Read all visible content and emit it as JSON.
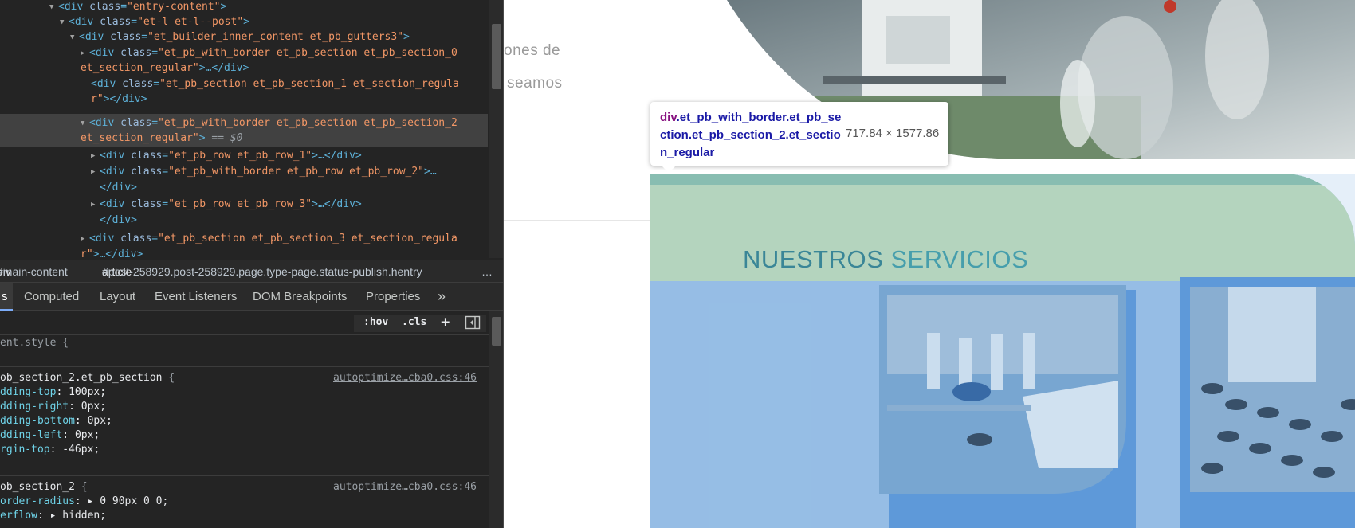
{
  "devtools": {
    "dom_tree": {
      "lines": [
        {
          "open": "<div ",
          "attr": "class",
          "value": "\"entry-content\"",
          "close": ">"
        },
        {
          "open": "<div ",
          "attr": "class",
          "value": "\"et-l et-l--post\"",
          "close": ">"
        },
        {
          "open": "<div ",
          "attr": "class",
          "value": "\"et_builder_inner_content et_pb_gutters3\"",
          "close": ">"
        },
        {
          "open": "<div ",
          "attr": "class",
          "value": "\"et_pb_with_border et_pb_section et_pb_section_0",
          "close": ""
        },
        {
          "open": "",
          "attr": "",
          "value": "et_section_regular\"",
          "close": ">…</div>"
        },
        {
          "open": "<div ",
          "attr": "class",
          "value": "\"et_pb_section et_pb_section_1 et_section_regula",
          "close": ""
        },
        {
          "open": "",
          "attr": "",
          "value": "r\"",
          "close": "></div>"
        },
        {
          "open": "<div ",
          "attr": "class",
          "value": "\"et_pb_with_border et_pb_section et_pb_section_2",
          "close": ""
        },
        {
          "open": "",
          "attr": "",
          "value": "et_section_regular\"",
          "close": ">",
          "suffix": " == $0"
        },
        {
          "open": "<div ",
          "attr": "class",
          "value": "\"et_pb_row et_pb_row_1\"",
          "close": ">…</div>"
        },
        {
          "open": "<div ",
          "attr": "class",
          "value": "\"et_pb_with_border et_pb_row et_pb_row_2\"",
          "close": ">…"
        },
        {
          "open": "</div>",
          "attr": "",
          "value": "",
          "close": ""
        },
        {
          "open": "<div ",
          "attr": "class",
          "value": "\"et_pb_row et_pb_row_3\"",
          "close": ">…</div>"
        },
        {
          "open": "</div>",
          "attr": "",
          "value": "",
          "close": ""
        },
        {
          "open": "<div ",
          "attr": "class",
          "value": "\"et_pb_section et_pb_section_3 et_section_regula",
          "close": ""
        },
        {
          "open": "",
          "attr": "",
          "value": "r\"",
          "close": ">…</div>"
        }
      ]
    },
    "breadcrumb": {
      "item1_tag": "div",
      "item1_rest": "#main-content",
      "item2_tag": "article",
      "item2_rest": "#post-258929.post-258929.page.type-page.status-publish.hentry",
      "more": "…"
    },
    "tabs": [
      "s",
      "Computed",
      "Layout",
      "Event Listeners",
      "DOM Breakpoints",
      "Properties",
      "»"
    ],
    "filter": {
      "hov": ":hov",
      "cls": ".cls",
      "plus": "+"
    },
    "styles": {
      "element_style": "ent.style {",
      "rule1_selector": "ob_section_2.et_pb_section",
      "rule1_source": "autoptimize…cba0.css:46",
      "rule1_props": [
        {
          "p": "dding-top",
          "v": "100px;"
        },
        {
          "p": "dding-right",
          "v": "0px;"
        },
        {
          "p": "dding-bottom",
          "v": "0px;"
        },
        {
          "p": "dding-left",
          "v": "0px;"
        },
        {
          "p": "rgin-top",
          "v": "-46px;"
        }
      ],
      "rule2_selector": "ob_section_2",
      "rule2_source": "autoptimize…cba0.css:46",
      "rule2_props": [
        {
          "p": "order-radius",
          "v": "▸ 0 90px 0 0;"
        },
        {
          "p": "erflow",
          "v": "▸ hidden;"
        }
      ]
    }
  },
  "page": {
    "para_line1": "ones  de",
    "para_line2": "seamos",
    "section_title_1": "NUESTROS",
    "section_title_2": "SERVICIOS"
  },
  "tooltip": {
    "tag": "div",
    "classes": ".et_pb_with_border.et_pb_section.et_pb_section_2.et_section_regular",
    "size": "717.84 × 1577.86"
  }
}
